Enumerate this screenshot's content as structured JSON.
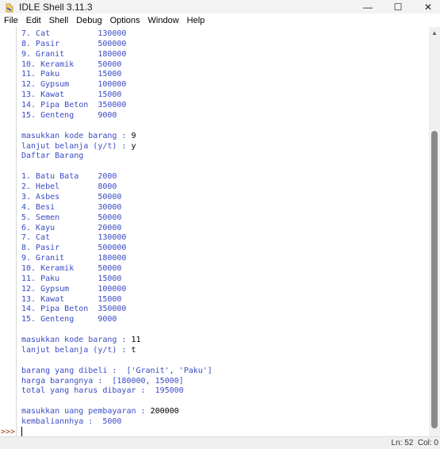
{
  "window": {
    "title": "IDLE Shell 3.11.3",
    "minimize": "—",
    "maximize": "☐",
    "close": "✕"
  },
  "menu": [
    "File",
    "Edit",
    "Shell",
    "Debug",
    "Options",
    "Window",
    "Help"
  ],
  "shell": {
    "prompt": ">>>",
    "lines": [
      {
        "text": "7. Cat          130000",
        "kind": "out"
      },
      {
        "text": "8. Pasir        500000",
        "kind": "out"
      },
      {
        "text": "9. Granit       180000",
        "kind": "out"
      },
      {
        "text": "10. Keramik     50000",
        "kind": "out"
      },
      {
        "text": "11. Paku        15000",
        "kind": "out"
      },
      {
        "text": "12. Gypsum      100000",
        "kind": "out"
      },
      {
        "text": "13. Kawat       15000",
        "kind": "out"
      },
      {
        "text": "14. Pipa Beton  350000",
        "kind": "out"
      },
      {
        "text": "15. Genteng     9000",
        "kind": "out"
      },
      {
        "text": "",
        "kind": "out"
      },
      {
        "text": "masukkan kode barang : ",
        "kind": "out",
        "input": "9"
      },
      {
        "text": "lanjut belanja (y/t) : ",
        "kind": "out",
        "input": "y"
      },
      {
        "text": "Daftar Barang",
        "kind": "out"
      },
      {
        "text": "",
        "kind": "out"
      },
      {
        "text": "1. Batu Bata    2000",
        "kind": "out"
      },
      {
        "text": "2. Hebel        8000",
        "kind": "out"
      },
      {
        "text": "3. Asbes        50000",
        "kind": "out"
      },
      {
        "text": "4. Besi         30000",
        "kind": "out"
      },
      {
        "text": "5. Semen        50000",
        "kind": "out"
      },
      {
        "text": "6. Kayu         20000",
        "kind": "out"
      },
      {
        "text": "7. Cat          130000",
        "kind": "out"
      },
      {
        "text": "8. Pasir        500000",
        "kind": "out"
      },
      {
        "text": "9. Granit       180000",
        "kind": "out"
      },
      {
        "text": "10. Keramik     50000",
        "kind": "out"
      },
      {
        "text": "11. Paku        15000",
        "kind": "out"
      },
      {
        "text": "12. Gypsum      100000",
        "kind": "out"
      },
      {
        "text": "13. Kawat       15000",
        "kind": "out"
      },
      {
        "text": "14. Pipa Beton  350000",
        "kind": "out"
      },
      {
        "text": "15. Genteng     9000",
        "kind": "out"
      },
      {
        "text": "",
        "kind": "out"
      },
      {
        "text": "masukkan kode barang : ",
        "kind": "out",
        "input": "11"
      },
      {
        "text": "lanjut belanja (y/t) : ",
        "kind": "out",
        "input": "t"
      },
      {
        "text": "",
        "kind": "out"
      },
      {
        "text": "barang yang dibeli :  ['Granit', 'Paku']",
        "kind": "out"
      },
      {
        "text": "harga barangnya :  [180000, 15000]",
        "kind": "out"
      },
      {
        "text": "total yang harus dibayar :  195000",
        "kind": "out"
      },
      {
        "text": "",
        "kind": "out"
      },
      {
        "text": "masukkan uang pembayaran : ",
        "kind": "out",
        "input": "200000"
      },
      {
        "text": "kembaliannhya :  5000",
        "kind": "out"
      }
    ]
  },
  "status": {
    "position": "Ln: 52  Col: 0"
  }
}
